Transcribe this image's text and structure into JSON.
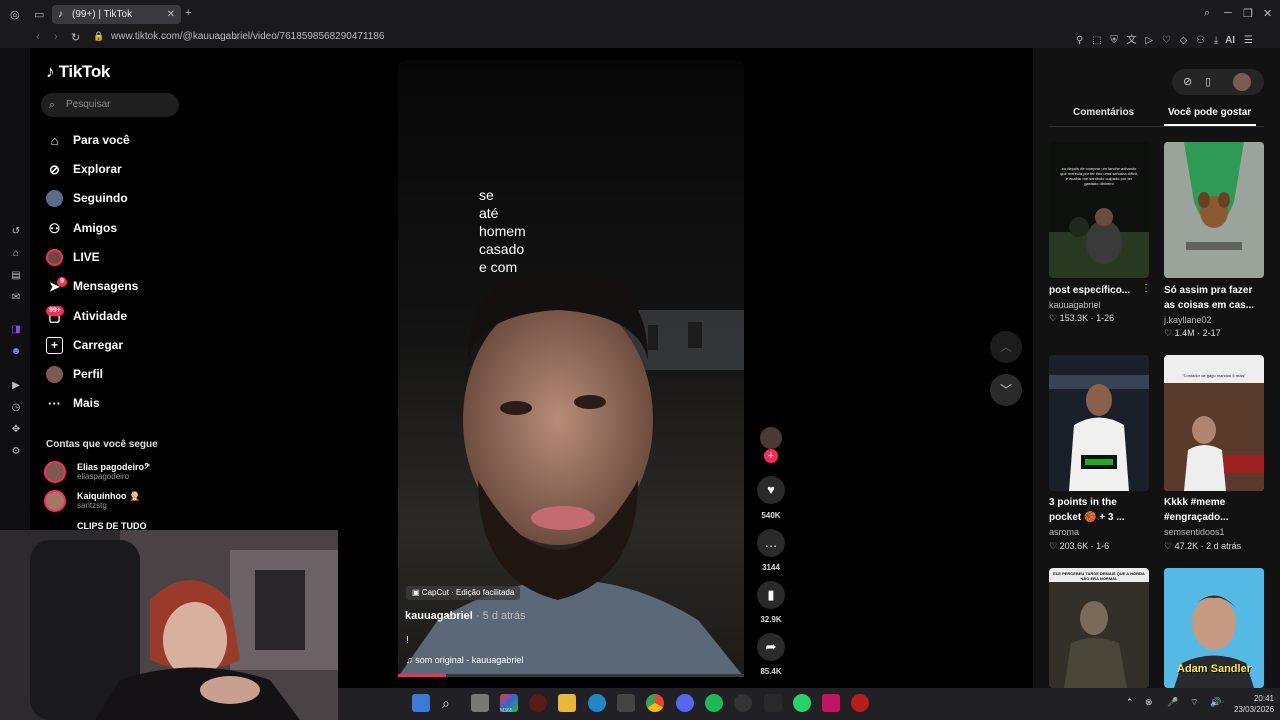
{
  "browser": {
    "tab_title": "(99+) | TikTok",
    "url": "www.tiktok.com/@kauuagabriel/video/7618598568290471186",
    "ai_label": "AI"
  },
  "sidebar": {
    "logo": "TikTok",
    "search_placeholder": "Pesquisar",
    "nav": [
      {
        "label": "Para você",
        "icon": "home-icon"
      },
      {
        "label": "Explorar",
        "icon": "compass-icon"
      },
      {
        "label": "Seguindo",
        "icon": "following-avatar-icon"
      },
      {
        "label": "Amigos",
        "icon": "friends-icon"
      },
      {
        "label": "LIVE",
        "icon": "live-icon"
      },
      {
        "label": "Mensagens",
        "icon": "messages-icon",
        "badge": "9"
      },
      {
        "label": "Atividade",
        "icon": "activity-icon",
        "badge": "99+"
      },
      {
        "label": "Carregar",
        "icon": "upload-icon"
      },
      {
        "label": "Perfil",
        "icon": "profile-icon"
      },
      {
        "label": "Mais",
        "icon": "more-icon"
      }
    ],
    "following_title": "Contas que você segue",
    "following": [
      {
        "name": "Elias pagodeiro𝄢",
        "handle": "eliaspagodeiro"
      },
      {
        "name": "Kaiquinhoo 🤶",
        "handle": "santzstg"
      },
      {
        "name": "CLIPS DE TUDO",
        "handle": ""
      }
    ]
  },
  "video": {
    "overlay_lines": [
      "se",
      "até",
      "homem",
      "casado",
      "e com"
    ],
    "capcut_label": "CapCut · Edição facilitada",
    "author": "kauuagabriel",
    "time_ago": "· 5 d atrás",
    "description": "!",
    "sound": "som original - kauuagabriel",
    "progress": 0.14,
    "likes": "540K",
    "comments": "3144",
    "saves": "32.9K",
    "shares": "85.4K"
  },
  "right_panel": {
    "tabs": [
      "Comentários",
      "Você pode gostar"
    ],
    "active_tab": "Você pode gostar",
    "items": [
      {
        "title": "post específico...",
        "handle": "kauuagabriel",
        "likes": "153.3K",
        "age": "1-26",
        "overlay": "eu depois de comprar um lanche achando que merecia por ter tido uma semana difícil, e acabar me sentindo culpado por ter gastado dinheiro"
      },
      {
        "title": "Só assim pra fazer as coisas em cas...",
        "handle": "j.kayllane02",
        "likes": "1.4M",
        "age": "2-17",
        "overlay": ""
      },
      {
        "title": "3 points in the pocket 🏀 + 3 ...",
        "handle": "asroma",
        "likes": "203.6K",
        "age": "1-6",
        "overlay": ""
      },
      {
        "title": "Kkkk #meme #engraçado...",
        "handle": "semsentidoos1",
        "likes": "47.2K",
        "age": "2 d atrás",
        "overlay": "\"Contador de gago mandou 5 reais\""
      },
      {
        "title": "",
        "handle": "",
        "likes": "",
        "age": "",
        "overlay": "ELE PERCEBEU TARDE DEMAIS QUE A HORDA NÃO ERA NORMAL"
      },
      {
        "title": "",
        "handle": "",
        "likes": "",
        "age": "",
        "overlay": "Adam Sandler"
      }
    ]
  },
  "taskbar": {
    "time": "20:41",
    "date": "23/03/2026",
    "m365_label": "M365"
  },
  "colors": {
    "accent": "#fe2c55",
    "background": "#000000",
    "panel": "#121212"
  }
}
